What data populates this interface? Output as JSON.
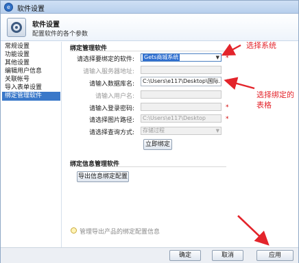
{
  "window": {
    "title": "软件设置"
  },
  "header": {
    "title": "软件设置",
    "subtitle": "配置软件的各个参数"
  },
  "sidebar": {
    "items": [
      {
        "label": "常规设置"
      },
      {
        "label": "功能设置"
      },
      {
        "label": "其他设置"
      },
      {
        "label": "编辑用户信息"
      },
      {
        "label": "关联帐号"
      },
      {
        "label": "导入表单设置"
      },
      {
        "label": "绑定管理软件",
        "selected": true
      }
    ]
  },
  "binding": {
    "section_title": "绑定管理软件",
    "software_label": "请选择要绑定的软件:",
    "software_value": "Gets商城系统",
    "server_label": "请输入服务器地址:",
    "server_value": "",
    "db_label": "请输入数据库名:",
    "db_value": "C:\\Users\\e117\\Desktop\\国际...",
    "user_label": "请输入用户名:",
    "user_value": "",
    "password_label": "请输入登录密码:",
    "password_value": "",
    "image_path_label": "请选择图片路径:",
    "image_path_value": "C:\\Users\\e117\\Desktop",
    "query_label": "请选择查询方式:",
    "query_value": "存储过程",
    "required_mark": "*",
    "bind_button": "立即绑定"
  },
  "info": {
    "section_title": "绑定信息管理软件",
    "export_button": "导出信息绑定配置",
    "hint": "管理导出产品的绑定配置信息"
  },
  "footer": {
    "ok": "确定",
    "cancel": "取消",
    "apply": "应用"
  },
  "annotations": {
    "select_system": "选择系统",
    "select_table_line1": "选择绑定的",
    "select_table_line2": "表格"
  },
  "colors": {
    "selection_blue": "#3a78c9",
    "annotation_red": "#e3242b",
    "required_red": "#d10000"
  }
}
